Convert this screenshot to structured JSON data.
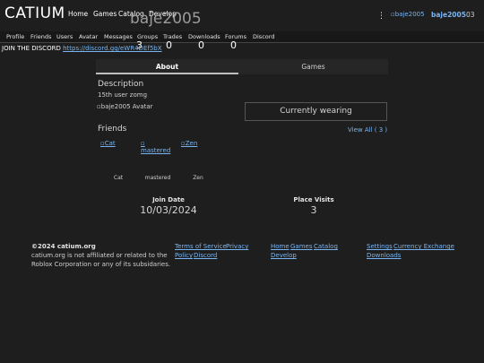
{
  "navbar": {
    "brand": "CATIUM",
    "links": [
      "Home",
      "Games",
      "Catalog",
      "Develop"
    ],
    "avatar_alt": "baje2005",
    "username": "baje2005",
    "currency": "03"
  },
  "profile": {
    "name_overlay": "baje2005",
    "stats": [
      "3",
      "0",
      "0",
      "0"
    ]
  },
  "subnav": [
    "Profile",
    "Friends",
    "Users",
    "Avatar",
    "Messages",
    "Groups",
    "Trades",
    "Downloads",
    "Forums",
    "Discord"
  ],
  "discord_banner": {
    "text": "JOIN THE DISCORD",
    "link": "https://discord.gg/eWR4DEf5bX"
  },
  "tabs": [
    "About",
    "Games"
  ],
  "about": {
    "description_heading": "Description",
    "description_text": "15th user zomg",
    "avatar_alt": "baje2005 Avatar",
    "currently_wearing": "Currently wearing"
  },
  "friends": {
    "heading": "Friends",
    "view_all": "View All ( 3 )",
    "items": [
      {
        "img_alt": "Cat",
        "name": "Cat"
      },
      {
        "img_alt": "mastered",
        "name": "mastered"
      },
      {
        "img_alt": "Zen",
        "name": "Zen"
      }
    ]
  },
  "stats_bottom": {
    "join_label": "Join Date",
    "join_value": "10/03/2024",
    "visits_label": "Place Visits",
    "visits_value": "3"
  },
  "footer": {
    "copyright": "©2024 catium.org",
    "disclaimer_1": "catium.org is not affiliated or related to the",
    "disclaimer_2": "Roblox Corporation or any of its subsidaries.",
    "col1": [
      "Terms of Service",
      "Privacy",
      "Policy",
      "Discord"
    ],
    "col2": [
      "Home",
      "Games",
      "Catalog",
      "Develop"
    ],
    "col3": [
      "Settings",
      "Currency Exchange",
      "Downloads"
    ]
  }
}
